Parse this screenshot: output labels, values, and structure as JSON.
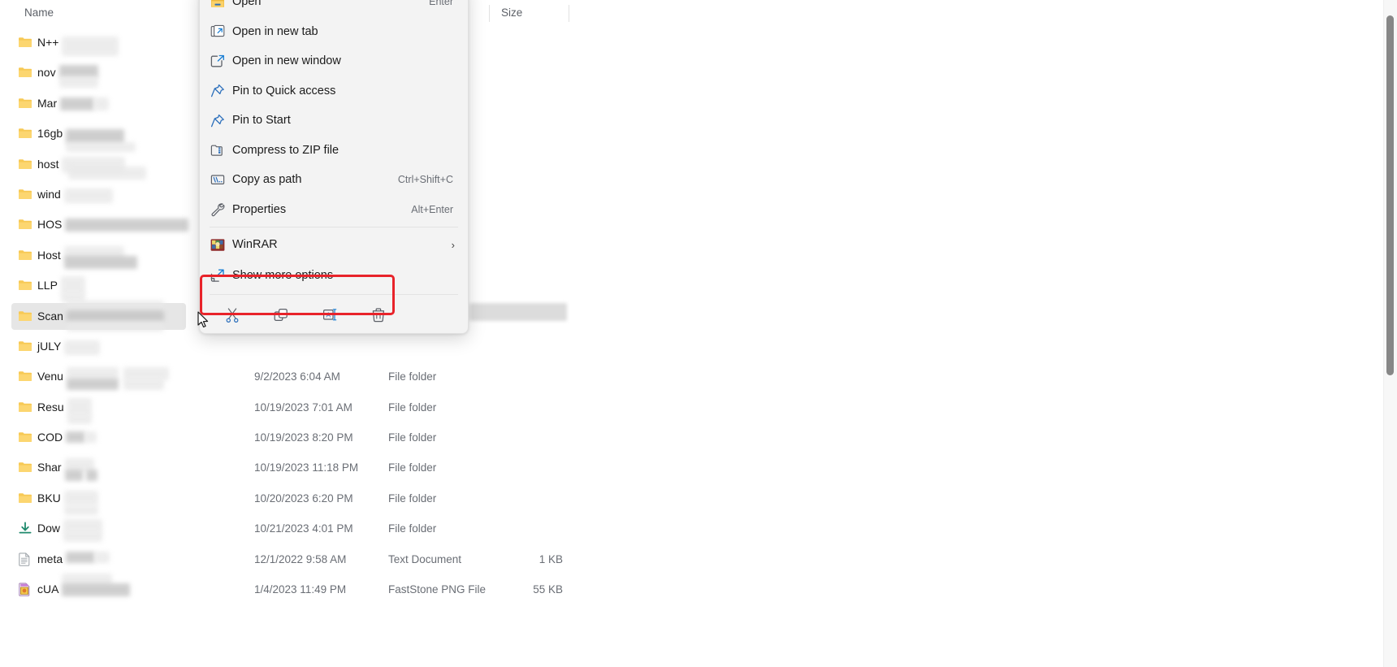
{
  "file_list": {
    "columns": [
      {
        "key": "name",
        "label": "Name"
      },
      {
        "key": "date",
        "label": ""
      },
      {
        "key": "type",
        "label": ""
      },
      {
        "key": "size",
        "label": "Size"
      }
    ],
    "header_name": "Name",
    "header_size": "Size",
    "rows": [
      {
        "icon": "folder-icon",
        "name": "N++",
        "date": "",
        "type": "",
        "size": "",
        "redacted": true,
        "selected": false
      },
      {
        "icon": "folder-icon",
        "name": "nov",
        "date": "",
        "type": "",
        "size": "",
        "redacted": true,
        "selected": false
      },
      {
        "icon": "folder-icon",
        "name": "Mar",
        "date": "",
        "type": "",
        "size": "",
        "redacted": true,
        "selected": false
      },
      {
        "icon": "folder-icon",
        "name": "16gb",
        "date": "",
        "type": "",
        "size": "",
        "redacted": true,
        "selected": false
      },
      {
        "icon": "folder-icon",
        "name": "host",
        "date": "",
        "type": "",
        "size": "",
        "redacted": true,
        "selected": false
      },
      {
        "icon": "folder-icon",
        "name": "wind",
        "date": "",
        "type": "",
        "size": "",
        "redacted": true,
        "selected": false
      },
      {
        "icon": "folder-icon",
        "name": "HOS",
        "date": "",
        "type": "",
        "size": "",
        "redacted": true,
        "selected": false
      },
      {
        "icon": "folder-icon",
        "name": "Host",
        "date": "",
        "type": "",
        "size": "",
        "redacted": true,
        "selected": false
      },
      {
        "icon": "folder-icon",
        "name": "LLP",
        "date": "",
        "type": "",
        "size": "",
        "redacted": true,
        "selected": false
      },
      {
        "icon": "folder-icon",
        "name": "Scan",
        "date": "",
        "type": "",
        "size": "",
        "redacted": true,
        "selected": true
      },
      {
        "icon": "folder-icon",
        "name": "jULY",
        "date": "",
        "type": "",
        "size": "",
        "redacted": true,
        "selected": false
      },
      {
        "icon": "folder-icon",
        "name": "Venu",
        "date": "9/2/2023 6:04 AM",
        "type": "File folder",
        "size": "",
        "redacted": true,
        "selected": false
      },
      {
        "icon": "folder-icon",
        "name": "Resu",
        "date": "10/19/2023 7:01 AM",
        "type": "File folder",
        "size": "",
        "redacted": true,
        "selected": false
      },
      {
        "icon": "folder-icon",
        "name": "COD",
        "date": "10/19/2023 8:20 PM",
        "type": "File folder",
        "size": "",
        "redacted": true,
        "selected": false
      },
      {
        "icon": "folder-icon",
        "name": "Shar",
        "date": "10/19/2023 11:18 PM",
        "type": "File folder",
        "size": "",
        "redacted": true,
        "selected": false
      },
      {
        "icon": "folder-icon",
        "name": "BKU",
        "date": "10/20/2023 6:20 PM",
        "type": "File folder",
        "size": "",
        "redacted": true,
        "selected": false
      },
      {
        "icon": "download-icon",
        "name": "Dow",
        "date": "10/21/2023 4:01 PM",
        "type": "File folder",
        "size": "",
        "redacted": true,
        "selected": false
      },
      {
        "icon": "text-file-icon",
        "name": "meta",
        "date": "12/1/2022 9:58 AM",
        "type": "Text Document",
        "size": "1 KB",
        "redacted": true,
        "selected": false
      },
      {
        "icon": "image-file-icon",
        "name": "cUA",
        "date": "1/4/2023 11:49 PM",
        "type": "FastStone PNG File",
        "size": "55 KB",
        "redacted": true,
        "selected": false
      }
    ]
  },
  "context_menu": {
    "items": [
      {
        "icon": "open-folder-icon",
        "label": "Open",
        "accel": "Enter",
        "submenu": false
      },
      {
        "icon": "new-tab-icon",
        "label": "Open in new tab",
        "accel": "",
        "submenu": false
      },
      {
        "icon": "new-window-icon",
        "label": "Open in new window",
        "accel": "",
        "submenu": false
      },
      {
        "icon": "pin-icon",
        "label": "Pin to Quick access",
        "accel": "",
        "submenu": false
      },
      {
        "icon": "pin-icon",
        "label": "Pin to Start",
        "accel": "",
        "submenu": false
      },
      {
        "icon": "zip-icon",
        "label": "Compress to ZIP file",
        "accel": "",
        "submenu": false
      },
      {
        "icon": "copy-path-icon",
        "label": "Copy as path",
        "accel": "Ctrl+Shift+C",
        "submenu": false
      },
      {
        "icon": "wrench-icon",
        "label": "Properties",
        "accel": "Alt+Enter",
        "submenu": false
      }
    ],
    "winrar": {
      "icon": "winrar-icon",
      "label": "WinRAR",
      "accel": "",
      "submenu": true
    },
    "show_more": {
      "icon": "show-more-icon",
      "label": "Show more options",
      "accel": ""
    },
    "toolbar_icons": [
      {
        "icon": "cut-icon",
        "label": "Cut"
      },
      {
        "icon": "copy-icon",
        "label": "Copy"
      },
      {
        "icon": "rename-icon",
        "label": "Rename"
      },
      {
        "icon": "delete-icon",
        "label": "Delete"
      }
    ],
    "highlight_color": "#e8232a"
  }
}
